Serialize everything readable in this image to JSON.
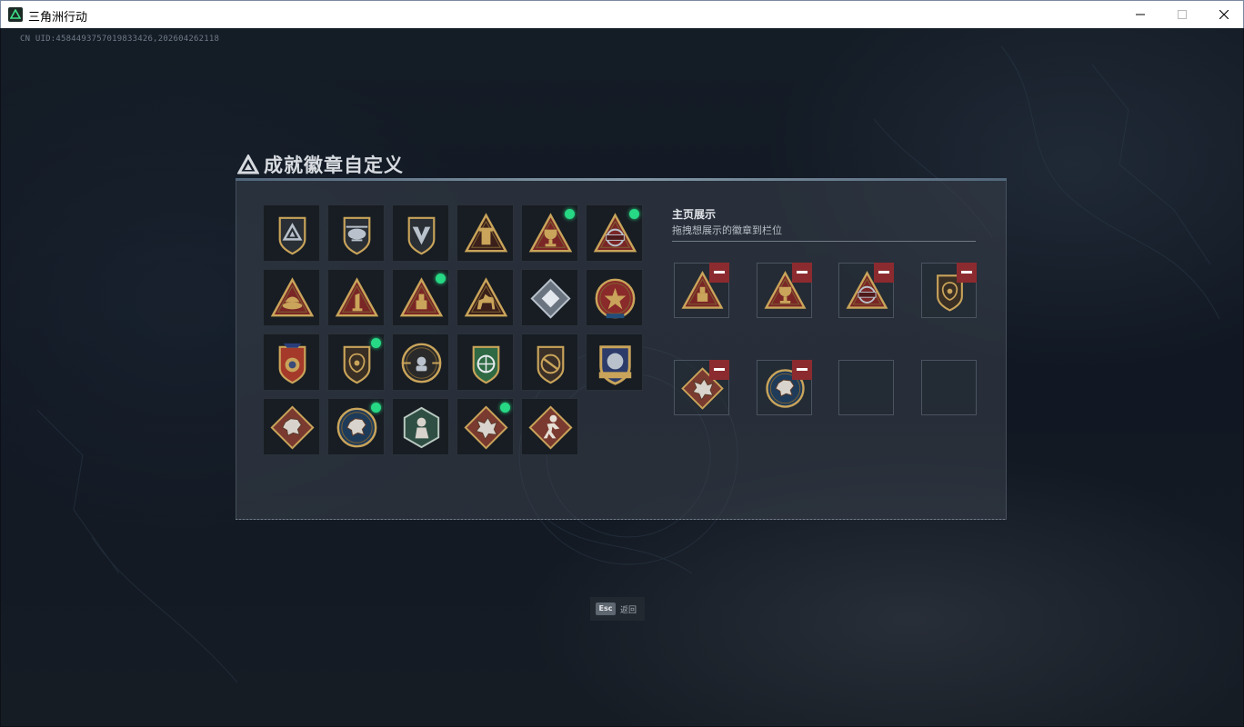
{
  "window": {
    "title": "三角洲行动",
    "controls": [
      "minimize",
      "maximize",
      "close"
    ]
  },
  "uid": "CN UID:4584493757019833426,202604262118",
  "panel": {
    "title": "成就徽章自定义",
    "logo_icon": "delta-triangle-icon"
  },
  "badges": [
    {
      "icon": "triangle-shield-badge",
      "new": false
    },
    {
      "icon": "helicopter-badge",
      "new": false
    },
    {
      "icon": "winged-shield-badge",
      "new": false
    },
    {
      "icon": "gold-tower-badge",
      "new": false
    },
    {
      "icon": "trophy-triangle-badge",
      "new": true
    },
    {
      "icon": "globe-triangle-badge",
      "new": true
    },
    {
      "icon": "gold-bowl-badge",
      "new": false
    },
    {
      "icon": "number-one-badge",
      "new": false
    },
    {
      "icon": "cargo-box-badge",
      "new": true
    },
    {
      "icon": "camel-badge",
      "new": false
    },
    {
      "icon": "silver-crystal-badge",
      "new": false
    },
    {
      "icon": "star-medal-badge",
      "new": false
    },
    {
      "icon": "police-star-badge",
      "new": false
    },
    {
      "icon": "lion-shield-badge",
      "new": true
    },
    {
      "icon": "sniper-scope-badge",
      "new": false
    },
    {
      "icon": "green-crosshair-badge",
      "new": false
    },
    {
      "icon": "rifle-shield-badge",
      "new": false
    },
    {
      "icon": "gold-crest-badge",
      "new": false
    },
    {
      "icon": "wolf-diamond-badge",
      "new": false
    },
    {
      "icon": "wolf-medallion-badge",
      "new": true
    },
    {
      "icon": "soldier-hexagon-badge",
      "new": false
    },
    {
      "icon": "dragon-diamond-badge",
      "new": true
    },
    {
      "icon": "runner-diamond-badge",
      "new": false
    }
  ],
  "showcase": {
    "title": "主页展示",
    "subtitle": "拖拽想展示的徽章到栏位",
    "slots": [
      {
        "icon": "cargo-box-badge",
        "removable": true
      },
      {
        "icon": "trophy-triangle-badge",
        "removable": true
      },
      {
        "icon": "globe-triangle-badge",
        "removable": true
      },
      {
        "icon": "lion-shield-badge",
        "removable": true
      },
      {
        "icon": "dragon-diamond-badge",
        "removable": true
      },
      {
        "icon": "wolf-medallion-badge",
        "removable": true
      },
      {
        "icon": null,
        "removable": false
      },
      {
        "icon": null,
        "removable": false
      }
    ]
  },
  "esc_hint": {
    "key": "Esc",
    "label": "返回"
  },
  "colors": {
    "accent_new": "#27d884",
    "remove": "#8c2b2f",
    "gold": "#c9a45a",
    "badge_bg": "#181d23"
  }
}
